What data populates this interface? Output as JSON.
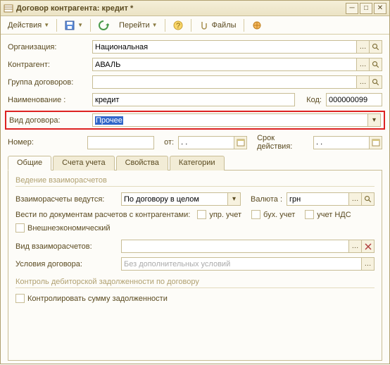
{
  "window": {
    "title": "Договор контрагента: кредит *"
  },
  "toolbar": {
    "actions": "Действия",
    "goto": "Перейти",
    "files": "Файлы"
  },
  "fields": {
    "org_lbl": "Организация:",
    "org_val": "Национальная",
    "contr_lbl": "Контрагент:",
    "contr_val": "АВАЛЬ",
    "group_lbl": "Группа договоров:",
    "group_val": "",
    "name_lbl": "Наименование :",
    "name_val": "кредит",
    "code_lbl": "Код:",
    "code_val": "000000099",
    "type_lbl": "Вид договора:",
    "type_val": "Прочее",
    "num_lbl": "Номер:",
    "num_val": "",
    "from_lbl": "от:",
    "from_val": " .  .    ",
    "valid_lbl": "Срок действия:",
    "valid_val": " .  .    "
  },
  "tabs": {
    "t1": "Общие",
    "t2": "Счета учета",
    "t3": "Свойства",
    "t4": "Категории"
  },
  "pane": {
    "sec1": "Ведение взаиморасчетов",
    "calc_lbl": "Взаиморасчеты ведутся:",
    "calc_val": "По договору в целом",
    "curr_lbl": "Валюта :",
    "curr_val": "грн",
    "docline": "Вести по документам расчетов с контрагентами:",
    "upr": "упр. учет",
    "buh": "бух. учет",
    "nds": "учет НДС",
    "foreign": "Внешнеэкономический",
    "kind_lbl": "Вид взаиморасчетов:",
    "cond_lbl": "Условия договора:",
    "cond_ph": "Без дополнительных условий",
    "sec2": "Контроль дебиторской задолженности по договору",
    "ctrl": "Контролировать сумму задолженности"
  }
}
